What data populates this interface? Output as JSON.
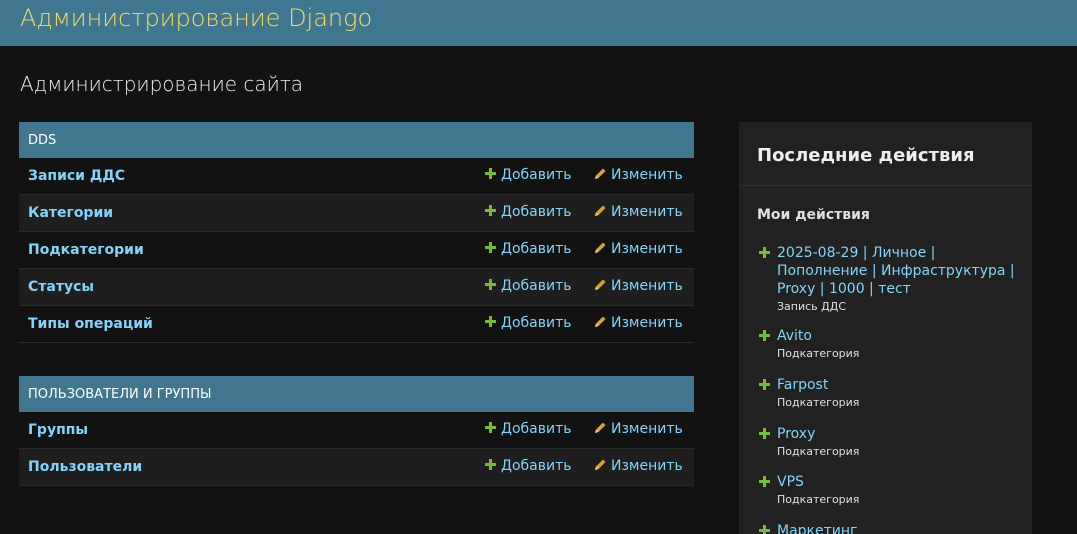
{
  "header": {
    "branding": "Администрирование Django"
  },
  "page_title": "Администрирование сайта",
  "modules": [
    {
      "caption": "DDS",
      "rows": [
        {
          "model": "Записи ДДС",
          "add": "Добавить",
          "change": "Изменить"
        },
        {
          "model": "Категории",
          "add": "Добавить",
          "change": "Изменить"
        },
        {
          "model": "Подкатегории",
          "add": "Добавить",
          "change": "Изменить"
        },
        {
          "model": "Статусы",
          "add": "Добавить",
          "change": "Изменить"
        },
        {
          "model": "Типы операций",
          "add": "Добавить",
          "change": "Изменить"
        }
      ]
    },
    {
      "caption": "ПОЛЬЗОВАТЕЛИ И ГРУППЫ",
      "rows": [
        {
          "model": "Группы",
          "add": "Добавить",
          "change": "Изменить"
        },
        {
          "model": "Пользователи",
          "add": "Добавить",
          "change": "Изменить"
        }
      ]
    }
  ],
  "recent_actions": {
    "title": "Последние действия",
    "subtitle": "Мои действия",
    "items": [
      {
        "text": "2025-08-29 | Личное | Пополнение | Инфраструктура | Proxy | 1000 | тест",
        "type": "Запись ДДС"
      },
      {
        "text": "Avito",
        "type": "Подкатегория"
      },
      {
        "text": "Farpost",
        "type": "Подкатегория"
      },
      {
        "text": "Proxy",
        "type": "Подкатегория"
      },
      {
        "text": "VPS",
        "type": "Подкатегория"
      },
      {
        "text": "Маркетинг",
        "type": ""
      }
    ]
  },
  "colors": {
    "header_bg": "#417690",
    "branding": "#f5dd5d",
    "link": "#81d4fa",
    "add_icon": "#70bf2b",
    "change_icon": "#d6a32b",
    "background": "#121212"
  },
  "icons": {
    "add": "plus-icon",
    "change": "pencil-icon"
  }
}
